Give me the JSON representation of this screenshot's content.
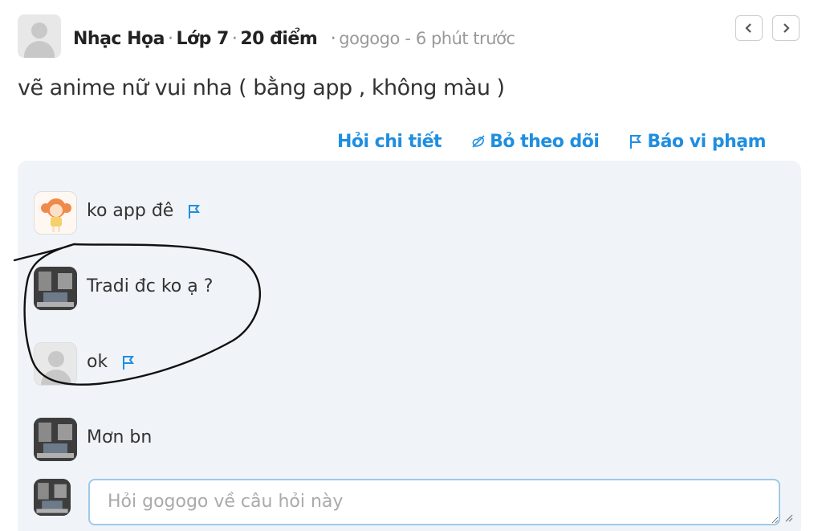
{
  "header": {
    "author": "Nhạc Họa",
    "grade": "Lớp 7",
    "points": "20 điểm",
    "username": "gogogo",
    "time": "6 phút trước",
    "separator": "-"
  },
  "question": {
    "text": "vẽ anime nữ vui nha ( bằng app , không màu )"
  },
  "actions": {
    "ask_detail": "Hỏi chi tiết",
    "unfollow": "Bỏ theo dõi",
    "report": "Báo vi phạm"
  },
  "comments": [
    {
      "text": "ko app đê",
      "avatar": "anime-girl",
      "flag": true
    },
    {
      "text": "Tradi đc ko ạ ?",
      "avatar": "photo",
      "flag": false
    },
    {
      "text": "ok",
      "avatar": "default",
      "flag": true
    },
    {
      "text": "Mơn bn",
      "avatar": "photo",
      "flag": false
    }
  ],
  "reply": {
    "placeholder": "Hỏi gogogo về câu hỏi này"
  },
  "colors": {
    "accent": "#1f8ee0",
    "panel": "#f0f4f8",
    "input_border": "#9fc9e8"
  }
}
